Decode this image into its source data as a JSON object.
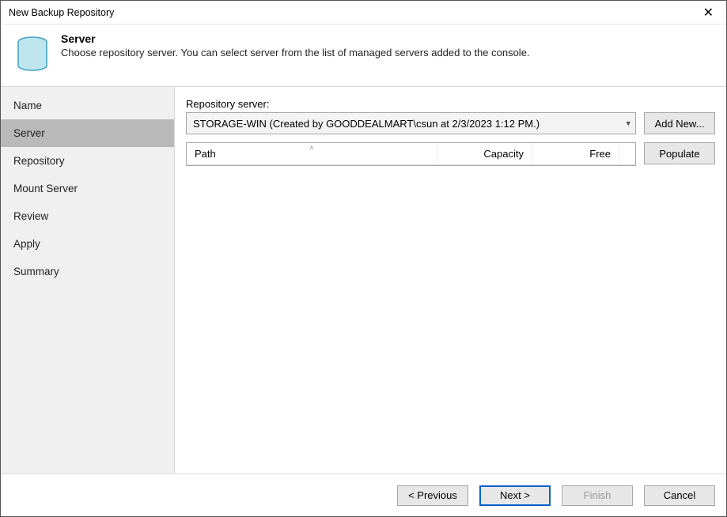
{
  "window": {
    "title": "New Backup Repository"
  },
  "header": {
    "title": "Server",
    "subtitle": "Choose repository server. You can select server from the list of managed servers added to the console."
  },
  "sidebar": {
    "items": [
      {
        "label": "Name"
      },
      {
        "label": "Server"
      },
      {
        "label": "Repository"
      },
      {
        "label": "Mount Server"
      },
      {
        "label": "Review"
      },
      {
        "label": "Apply"
      },
      {
        "label": "Summary"
      }
    ],
    "selected_index": 1
  },
  "main": {
    "repo_server_label": "Repository server:",
    "repo_server_value": "STORAGE-WIN (Created by GOODDEALMART\\csun at 2/3/2023 1:12 PM.)",
    "add_new_label": "Add New...",
    "populate_label": "Populate",
    "columns": {
      "path": "Path",
      "capacity": "Capacity",
      "free": "Free"
    },
    "rows": []
  },
  "footer": {
    "previous": "< Previous",
    "next": "Next >",
    "finish": "Finish",
    "cancel": "Cancel"
  }
}
